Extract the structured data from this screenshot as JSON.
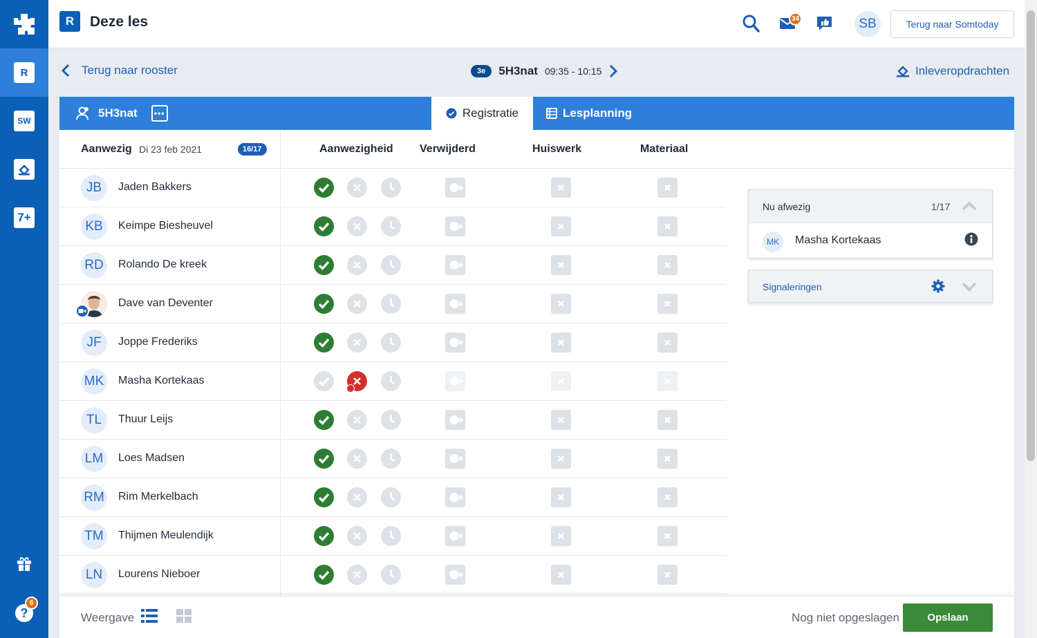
{
  "app": {
    "title": "Deze les",
    "app_letter": "R",
    "back_button": "Terug naar Somtoday",
    "user_initials": "SB",
    "mail_badge": "34",
    "help_badge": "6"
  },
  "rail": {
    "items": [
      {
        "icon": "rooster-icon",
        "label": "R"
      },
      {
        "icon": "studiewijzer-icon",
        "label": "SW"
      },
      {
        "icon": "inlever-icon",
        "label": ""
      },
      {
        "icon": "cijfers-icon",
        "label": "7+"
      }
    ]
  },
  "subnav": {
    "back_label": "Terug naar rooster",
    "period": "3e",
    "lesson": "5H3nat",
    "time": "09:35 - 10:15",
    "assignments_label": "Inleveropdrachten"
  },
  "tabs": {
    "group_name": "5H3nat",
    "registratie": "Registratie",
    "lesplanning": "Lesplanning"
  },
  "table": {
    "present_label": "Aanwezig",
    "date": "Di 23 feb 2021",
    "count": "16/17",
    "columns": [
      "Aanwezigheid",
      "Verwijderd",
      "Huiswerk",
      "Materiaal"
    ],
    "students": [
      {
        "initials": "JB",
        "name": "Jaden Bakkers",
        "status": "present"
      },
      {
        "initials": "KB",
        "name": "Keimpe Biesheuvel",
        "status": "present"
      },
      {
        "initials": "RD",
        "name": "Rolando De kreek",
        "status": "present"
      },
      {
        "initials": "",
        "name": "Dave van Deventer",
        "status": "present",
        "photo": true
      },
      {
        "initials": "JF",
        "name": "Joppe Frederiks",
        "status": "present"
      },
      {
        "initials": "MK",
        "name": "Masha Kortekaas",
        "status": "absent"
      },
      {
        "initials": "TL",
        "name": "Thuur Leijs",
        "status": "present"
      },
      {
        "initials": "LM",
        "name": "Loes Madsen",
        "status": "present"
      },
      {
        "initials": "RM",
        "name": "Rim Merkelbach",
        "status": "present"
      },
      {
        "initials": "TM",
        "name": "Thijmen Meulendijk",
        "status": "present"
      },
      {
        "initials": "LN",
        "name": "Lourens Nieboer",
        "status": "present"
      }
    ]
  },
  "absent_card": {
    "label": "Nu afwezig",
    "count": "1/17",
    "student_initials": "MK",
    "student_name": "Masha Kortekaas"
  },
  "signals_card": {
    "label": "Signaleringen"
  },
  "footer": {
    "view_label": "Weergave",
    "status": "Nog niet opgeslagen",
    "save_label": "Opslaan"
  },
  "colors": {
    "brand": "#0b5fb7",
    "tab_blue": "#2e7fd9",
    "present_green": "#2e7d32",
    "absent_red": "#d32f2f",
    "badge_orange": "#e07010",
    "save_green": "#3a8a3a"
  }
}
